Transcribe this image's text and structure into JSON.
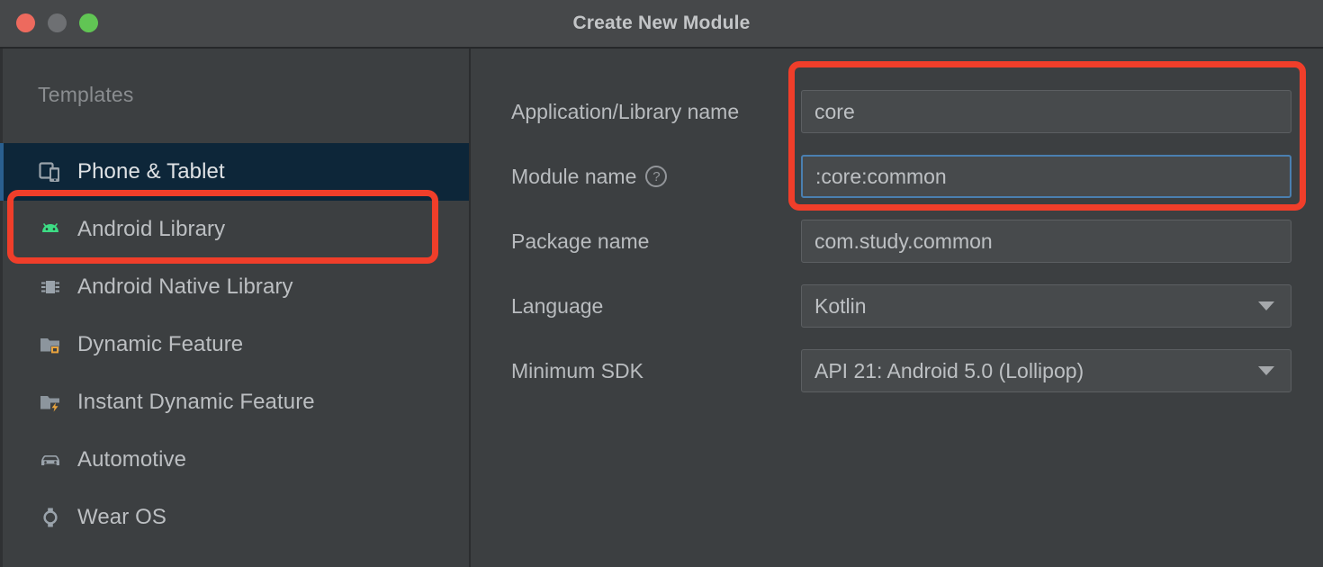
{
  "window": {
    "title": "Create New Module",
    "traffic_lights": [
      "close-button",
      "minimize-button",
      "maximize-button"
    ]
  },
  "sidebar": {
    "header": "Templates",
    "items": [
      {
        "label": "Phone & Tablet",
        "icon": "phone-tablet-icon",
        "selected": true
      },
      {
        "label": "Android Library",
        "icon": "android-robot-icon",
        "selected": false
      },
      {
        "label": "Android Native Library",
        "icon": "chip-icon",
        "selected": false
      },
      {
        "label": "Dynamic Feature",
        "icon": "folder-module-icon",
        "selected": false
      },
      {
        "label": "Instant Dynamic Feature",
        "icon": "folder-lightning-icon",
        "selected": false
      },
      {
        "label": "Automotive",
        "icon": "car-icon",
        "selected": false
      },
      {
        "label": "Wear OS",
        "icon": "watch-icon",
        "selected": false
      }
    ]
  },
  "form": {
    "fields": [
      {
        "label": "Application/Library name",
        "value": "core",
        "type": "text",
        "focused": false,
        "help": false
      },
      {
        "label": "Module name",
        "value": ":core:common",
        "type": "text",
        "focused": true,
        "help": true
      },
      {
        "label": "Package name",
        "value": "com.study.common",
        "type": "text",
        "focused": false,
        "help": false
      },
      {
        "label": "Language",
        "value": "Kotlin",
        "type": "select",
        "focused": false,
        "help": false
      },
      {
        "label": "Minimum SDK",
        "value": "API 21: Android 5.0 (Lollipop)",
        "type": "select",
        "focused": false,
        "help": false
      }
    ],
    "help_glyph": "?"
  },
  "annotations": [
    {
      "name": "highlight-phone-tablet",
      "color": "#f03e2a"
    },
    {
      "name": "highlight-name-fields",
      "color": "#f03e2a"
    }
  ]
}
